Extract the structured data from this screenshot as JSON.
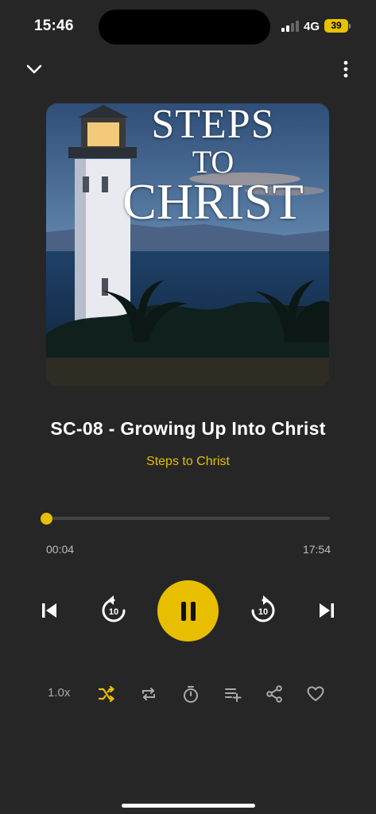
{
  "status_bar": {
    "time": "15:46",
    "network": "4G",
    "battery": "39"
  },
  "top_bar": {
    "collapse_icon": "chevron-down-icon",
    "more_icon": "more-vertical-icon"
  },
  "artwork": {
    "title_line1": "STEPS",
    "title_line2": "TO",
    "title_line3": "CHRIST"
  },
  "track": {
    "title": "SC-08 - Growing Up Into Christ",
    "artist": "Steps to Christ"
  },
  "progress": {
    "elapsed": "00:04",
    "total": "17:54",
    "fraction": 0.004
  },
  "controls": {
    "previous_icon": "skip-previous-icon",
    "rewind_icon": "rewind-10-icon",
    "rewind_label": "10",
    "play_pause_icon": "pause-icon",
    "forward_icon": "forward-10-icon",
    "forward_label": "10",
    "next_icon": "skip-next-icon"
  },
  "bottom_bar": {
    "speed": "1.0x",
    "icons": [
      "shuffle-icon",
      "repeat-icon",
      "timer-icon",
      "add-to-queue-icon",
      "share-icon",
      "heart-icon"
    ]
  },
  "colors": {
    "background": "#262626",
    "accent": "#e8bf00",
    "muted_text": "#bdbdbd"
  }
}
